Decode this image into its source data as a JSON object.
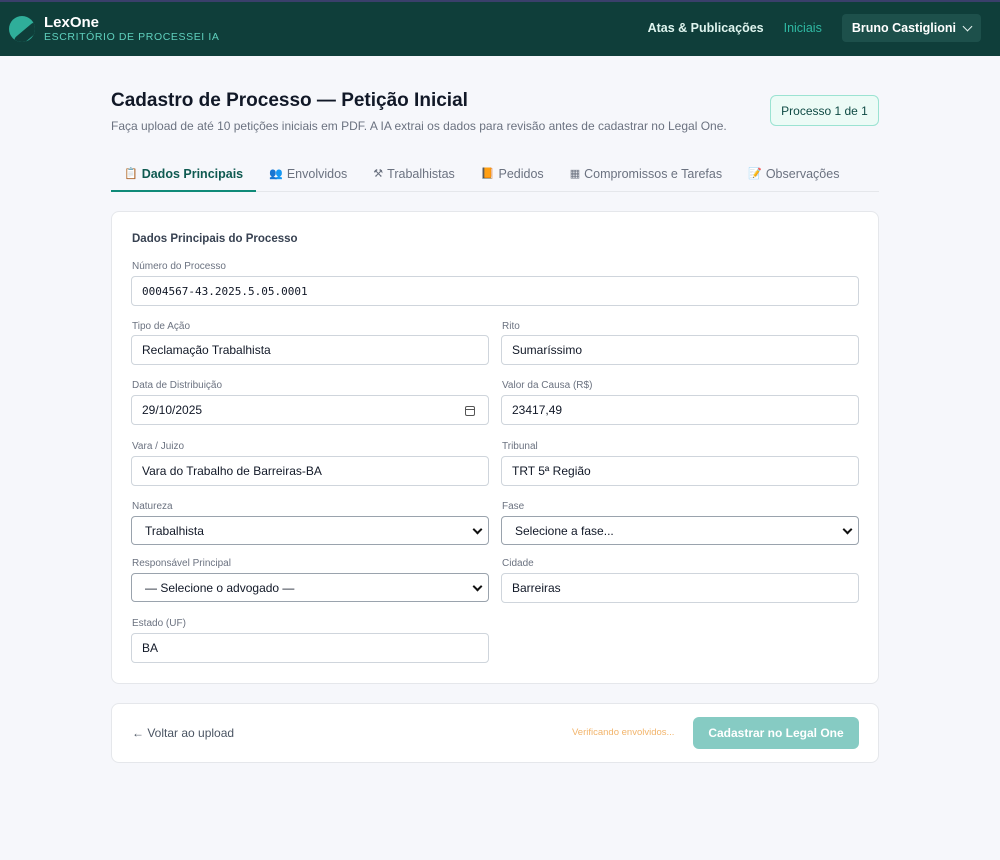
{
  "header": {
    "brand_name": "LexOne",
    "brand_sub": "ESCRITÓRIO DE PROCESSEI IA",
    "nav": [
      {
        "label": "Atas & Publicações"
      },
      {
        "label": "Iniciais"
      }
    ],
    "user_name": "Bruno Castiglioni"
  },
  "page": {
    "title": "Cadastro de Processo — Petição Inicial",
    "subtitle": "Faça upload de até 10 petições iniciais em PDF. A IA extrai os dados para revisão antes de cadastrar no Legal One.",
    "badge": "Processo 1 de 1"
  },
  "tabs": [
    {
      "icon": "📋",
      "label": "Dados Principais"
    },
    {
      "icon": "👥",
      "label": "Envolvidos"
    },
    {
      "icon": "⚒",
      "label": "Trabalhistas"
    },
    {
      "icon": "📙",
      "label": "Pedidos"
    },
    {
      "icon": "▦",
      "label": "Compromissos e Tarefas"
    },
    {
      "icon": "📝",
      "label": "Observações"
    }
  ],
  "form": {
    "section_title": "Dados Principais do Processo",
    "numero": {
      "label": "Número do Processo",
      "value": "0004567-43.2025.5.05.0001"
    },
    "tipo_acao": {
      "label": "Tipo de Ação",
      "value": "Reclamação Trabalhista"
    },
    "rito": {
      "label": "Rito",
      "value": "Sumaríssimo"
    },
    "data_distribuicao": {
      "label": "Data de Distribuição",
      "value": "29/10/2025"
    },
    "valor_causa": {
      "label": "Valor da Causa (R$)",
      "value": "23417,49"
    },
    "vara": {
      "label": "Vara / Juizo",
      "value": "Vara do Trabalho de Barreiras-BA"
    },
    "tribunal": {
      "label": "Tribunal",
      "value": "TRT 5ª Região"
    },
    "natureza": {
      "label": "Natureza",
      "value": "Trabalhista"
    },
    "fase": {
      "label": "Fase",
      "value": "Selecione a fase..."
    },
    "responsavel": {
      "label": "Responsável Principal",
      "value": "— Selecione o advogado —"
    },
    "cidade": {
      "label": "Cidade",
      "value": "Barreiras"
    },
    "estado": {
      "label": "Estado (UF)",
      "value": "BA"
    }
  },
  "footer": {
    "back_label": "← Voltar ao upload",
    "status_text": "Verificando envolvidos...",
    "submit_label": "Cadastrar no Legal One"
  }
}
